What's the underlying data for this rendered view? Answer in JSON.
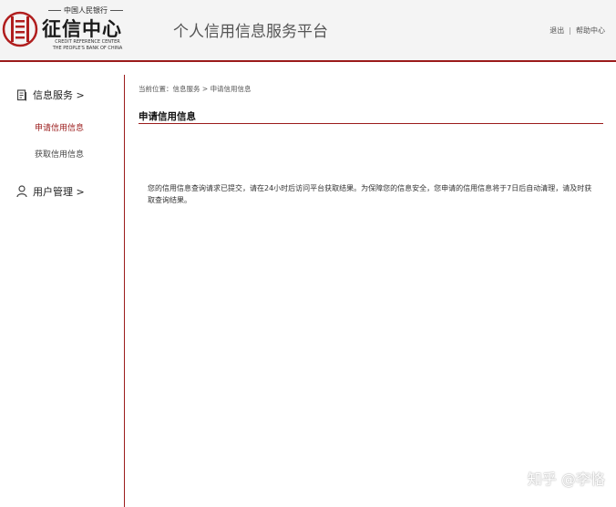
{
  "logo": {
    "top_text": "中国人民银行",
    "main_text": "征信中心",
    "en_line1": "CREDIT REFERENCE CENTER",
    "en_line2": "THE PEOPLE'S BANK OF CHINA"
  },
  "header": {
    "title": "个人信用信息服务平台",
    "logout": "退出",
    "separator": "|",
    "help": "帮助中心"
  },
  "sidebar": {
    "info_service": "信息服务 >",
    "apply_credit": "申请信用信息",
    "get_credit": "获取信用信息",
    "user_management": "用户管理 >"
  },
  "breadcrumb": {
    "prefix": "当前位置：",
    "level1": "信息服务",
    "sep": " > ",
    "level2": "申请信用信息"
  },
  "main": {
    "title": "申请信用信息",
    "message": "您的信用信息查询请求已提交，请在24小时后访问平台获取结果。为保障您的信息安全，您申请的信用信息将于7日后自动清理，请及时获取查询结果。"
  },
  "watermark": "知乎 @李恪",
  "colors": {
    "accent": "#9b1b1b",
    "header_bg": "#f4f4f4"
  }
}
